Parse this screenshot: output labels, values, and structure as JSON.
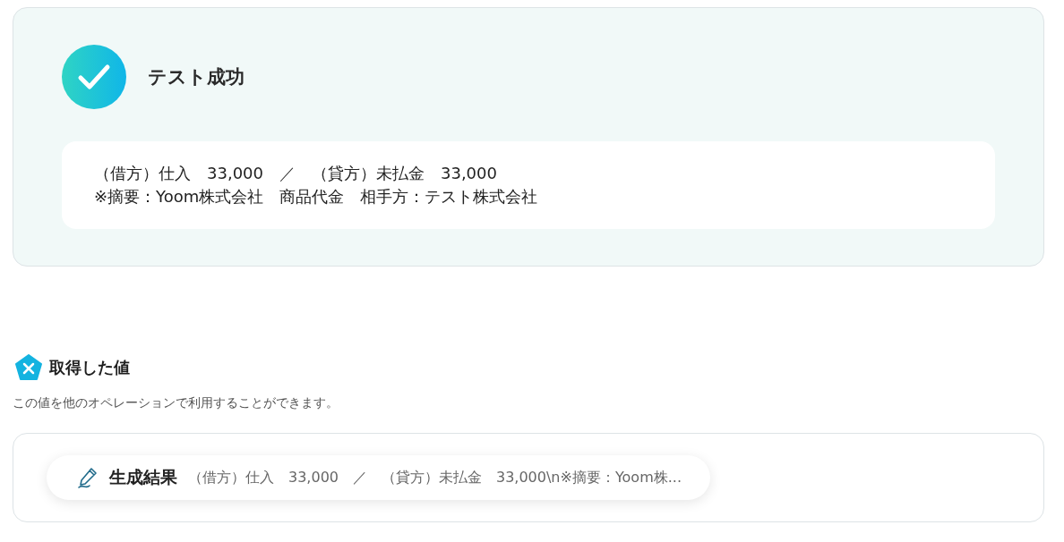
{
  "result": {
    "status": "テスト成功",
    "lines": [
      "（借方）仕入　33,000　／　（貸方）未払金　33,000",
      "※摘要：Yoom株式会社　商品代金　相手方：テスト株式会社"
    ]
  },
  "values": {
    "title": "取得した値",
    "description": "この値を他のオペレーションで利用することができます。",
    "items": [
      {
        "label": "生成結果",
        "value": "（借方）仕入　33,000　／　（貸方）未払金　33,000\\n※摘要：Yoom株..."
      }
    ]
  }
}
